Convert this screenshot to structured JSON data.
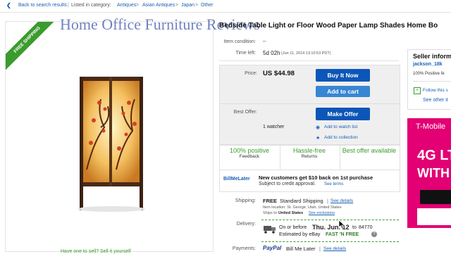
{
  "breadcrumb": {
    "back": "Back to search results",
    "divider": "|",
    "listed_in": "Listed in category:",
    "crumbs": [
      "Antiques",
      "Asian Antiques",
      "Japan",
      "Other"
    ],
    "gt": ">"
  },
  "listing": {
    "title": "Bedside Table Light or Floor Wood Paper Lamp Shades Home Bo",
    "watermark": "Home Office Furniture Reviews",
    "ribbon": "FREE SHIPPING",
    "condition_label": "Item condition:",
    "condition_value": "--",
    "time_left_label": "Time left:",
    "time_left_value": "5d 02h",
    "time_left_date": "(Jun 11, 2014   13:10:53 PDT)"
  },
  "purchase": {
    "price_label": "Price:",
    "price_value": "US $44.98",
    "buy_now": "Buy It Now",
    "add_to_cart": "Add to cart",
    "best_offer_label": "Best Offer:",
    "make_offer": "Make Offer",
    "watchers": "1 watcher",
    "add_watch": "Add to watch list",
    "add_collection": "Add to collection"
  },
  "badges": [
    {
      "big": "100% positive",
      "small": "Feedback"
    },
    {
      "big": "Hassle-free",
      "small": "Returns"
    },
    {
      "big": "Best offer available",
      "small": ""
    }
  ],
  "billmelater": {
    "logo": "BillMeLater",
    "headline": "New customers get $10 back on 1st purchase",
    "sub": "Subject to credit approval.",
    "terms": "See terms"
  },
  "shipping": {
    "label": "Shipping:",
    "free": "FREE",
    "standard": "Standard Shipping",
    "pipe": "|",
    "details": "See details",
    "location": "Item location:  St. George, Utah, United States",
    "ships_to_label": "Ships to:",
    "ships_to_value": "United States",
    "exclusions": "See exclusions"
  },
  "delivery": {
    "label": "Delivery:",
    "before": "On or before",
    "date": "Thu. Jun. 12",
    "to": "to",
    "zip": "84770",
    "estimated": "Estimated by eBay",
    "fast": "FAST 'N FREE"
  },
  "payments": {
    "label": "Payments:",
    "paypal": "PayPal",
    "bml": "Bill Me Later",
    "pipe": "|",
    "details": "See details"
  },
  "seller": {
    "header": "Seller inform",
    "name": "jackson_18k",
    "name_count": "(",
    "feedback": "100% Positive fe",
    "follow": "Follow this s",
    "other": "See other it"
  },
  "ad": {
    "brand": "T-Mobile",
    "line1": "4G LT",
    "line2": "WITH"
  },
  "bottom": {
    "text": "Have one to sell?  Sell it yourself"
  },
  "colors": {
    "accent_blue": "#0b56b8",
    "green": "#3a9b2e",
    "tmobile": "#e20074"
  }
}
